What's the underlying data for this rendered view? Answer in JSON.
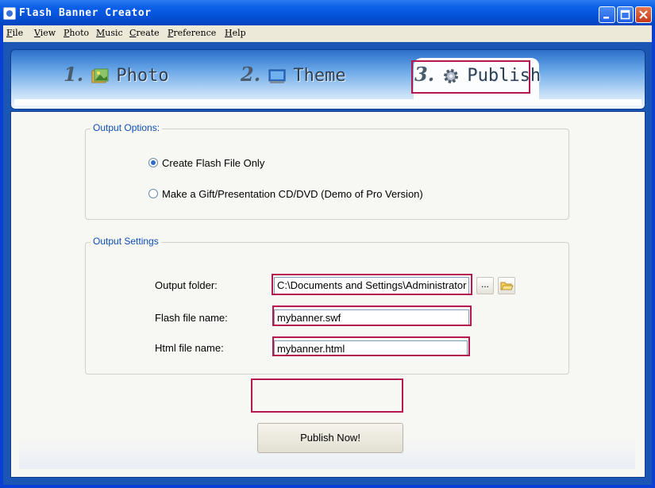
{
  "window": {
    "title": "Flash Banner Creator",
    "icons": [
      "app-icon",
      "minimize-icon",
      "maximize-icon",
      "close-icon"
    ]
  },
  "menu": [
    {
      "first": "F",
      "rest": "ile"
    },
    {
      "first": "V",
      "rest": "iew"
    },
    {
      "first": "P",
      "rest": "hoto"
    },
    {
      "first": "M",
      "rest": "usic"
    },
    {
      "first": "C",
      "rest": "reate"
    },
    {
      "first": "P",
      "rest": "reference"
    },
    {
      "first": "H",
      "rest": "elp"
    }
  ],
  "tabs": [
    {
      "num": "1.",
      "label": "Photo",
      "icon": "photo-icon"
    },
    {
      "num": "2.",
      "label": "Theme",
      "icon": "theme-icon"
    },
    {
      "num": "3.",
      "label": "Publish",
      "icon": "gear-icon",
      "active": true
    }
  ],
  "output_options": {
    "legend": "Output Options:",
    "options": [
      {
        "label": "Create Flash File Only",
        "selected": true
      },
      {
        "label": "Make a Gift/Presentation CD/DVD (Demo of Pro Version)",
        "selected": false
      }
    ]
  },
  "output_settings": {
    "legend": "Output Settings",
    "folder_label": "Output folder:",
    "folder_value": "C:\\Documents and Settings\\Administrator",
    "browse_label": "...",
    "flash_label": "Flash file name:",
    "flash_value": "mybanner.swf",
    "html_label": "Html file name:",
    "html_value": "mybanner.html"
  },
  "publish_button": "Publish Now!",
  "colors": {
    "highlight": "#b5174f",
    "title_bar": "#0a5ee8",
    "legend_text": "#0b4eb8"
  }
}
